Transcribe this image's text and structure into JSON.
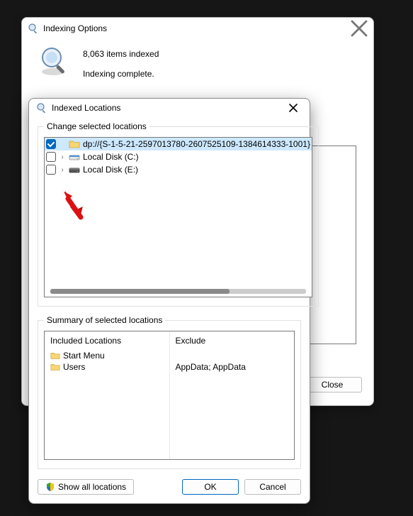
{
  "parent": {
    "title": "Indexing Options",
    "items_indexed": "8,063 items indexed",
    "status": "Indexing complete.",
    "close_label": "Close"
  },
  "child": {
    "title": "Indexed Locations",
    "group1_legend": "Change selected locations",
    "tree": [
      {
        "checked": true,
        "expandable": false,
        "icon": "folder",
        "label": "dp://{S-1-5-21-2597013780-2607525109-1384614333-1001}",
        "selected": true
      },
      {
        "checked": false,
        "expandable": true,
        "icon": "drive-c",
        "label": "Local Disk (C:)",
        "selected": false
      },
      {
        "checked": false,
        "expandable": true,
        "icon": "drive-e",
        "label": "Local Disk (E:)",
        "selected": false
      }
    ],
    "group2_legend": "Summary of selected locations",
    "summary": {
      "included_header": "Included Locations",
      "excluded_header": "Exclude",
      "included": [
        "Start Menu",
        "Users"
      ],
      "excluded": [
        "",
        "AppData; AppData"
      ]
    },
    "show_all_label": "Show all locations",
    "ok_label": "OK",
    "cancel_label": "Cancel"
  }
}
